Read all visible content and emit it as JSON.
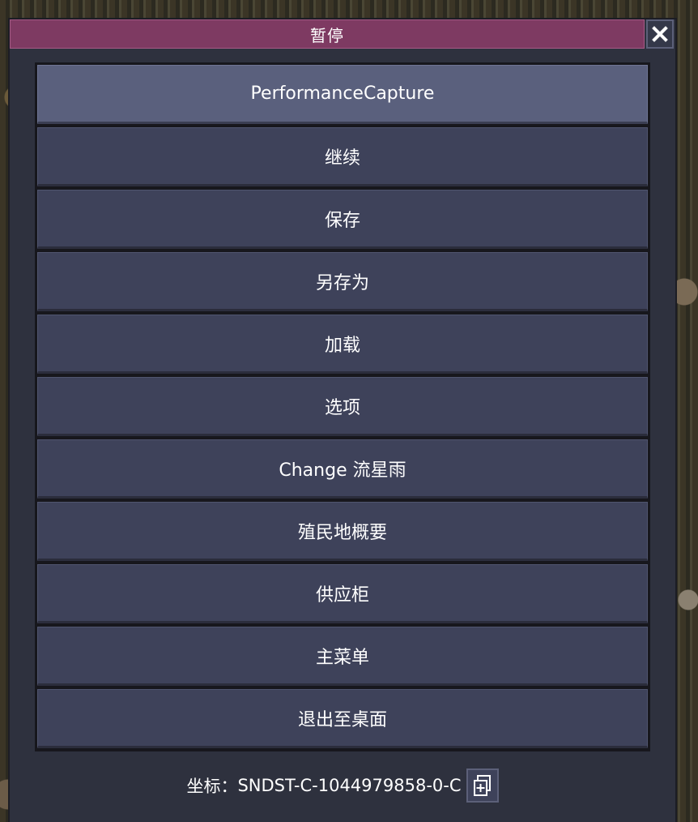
{
  "dialog": {
    "title": "暂停",
    "close_icon": "close-icon"
  },
  "menu": {
    "items": [
      {
        "label": "PerformanceCapture",
        "hovered": true
      },
      {
        "label": "继续"
      },
      {
        "label": "保存"
      },
      {
        "label": "另存为"
      },
      {
        "label": "加载"
      },
      {
        "label": "选项"
      },
      {
        "label": "Change 流星雨"
      },
      {
        "label": "殖民地概要"
      },
      {
        "label": "供应柜"
      },
      {
        "label": "主菜单"
      },
      {
        "label": "退出至桌面"
      }
    ]
  },
  "footer": {
    "coord_label": "坐标：",
    "coord_value": "SNDST-C-1044979858-0-C",
    "copy_icon": "copy-icon"
  },
  "colors": {
    "title_bar": "#7e3a62",
    "button": "#3e425a",
    "button_hover": "#5a607d",
    "dialog_bg": "#2e313e"
  }
}
